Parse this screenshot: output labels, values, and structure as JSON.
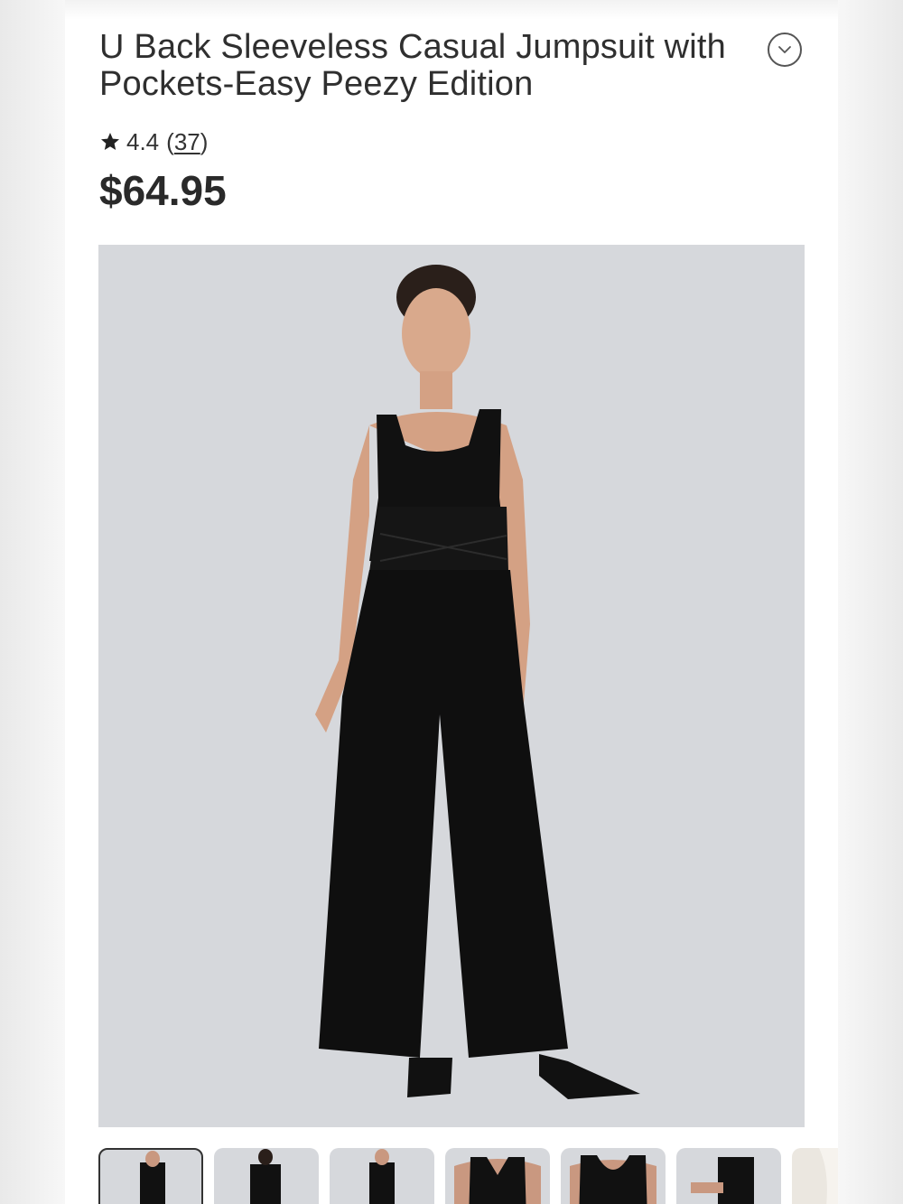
{
  "product": {
    "title": "U Back Sleeveless Casual Jumpsuit with Pockets-Easy Peezy Edition",
    "rating": "4.4",
    "review_count": "37",
    "price": "$64.95"
  },
  "icons": {
    "collapse": "chevron-down-icon",
    "rating": "star-icon"
  },
  "gallery": {
    "thumbnail_count": 7,
    "active_thumbnail": 1
  },
  "colors": {
    "text": "#2b2b2b",
    "image_bg": "#d6d8dc",
    "garment": "#111111"
  }
}
